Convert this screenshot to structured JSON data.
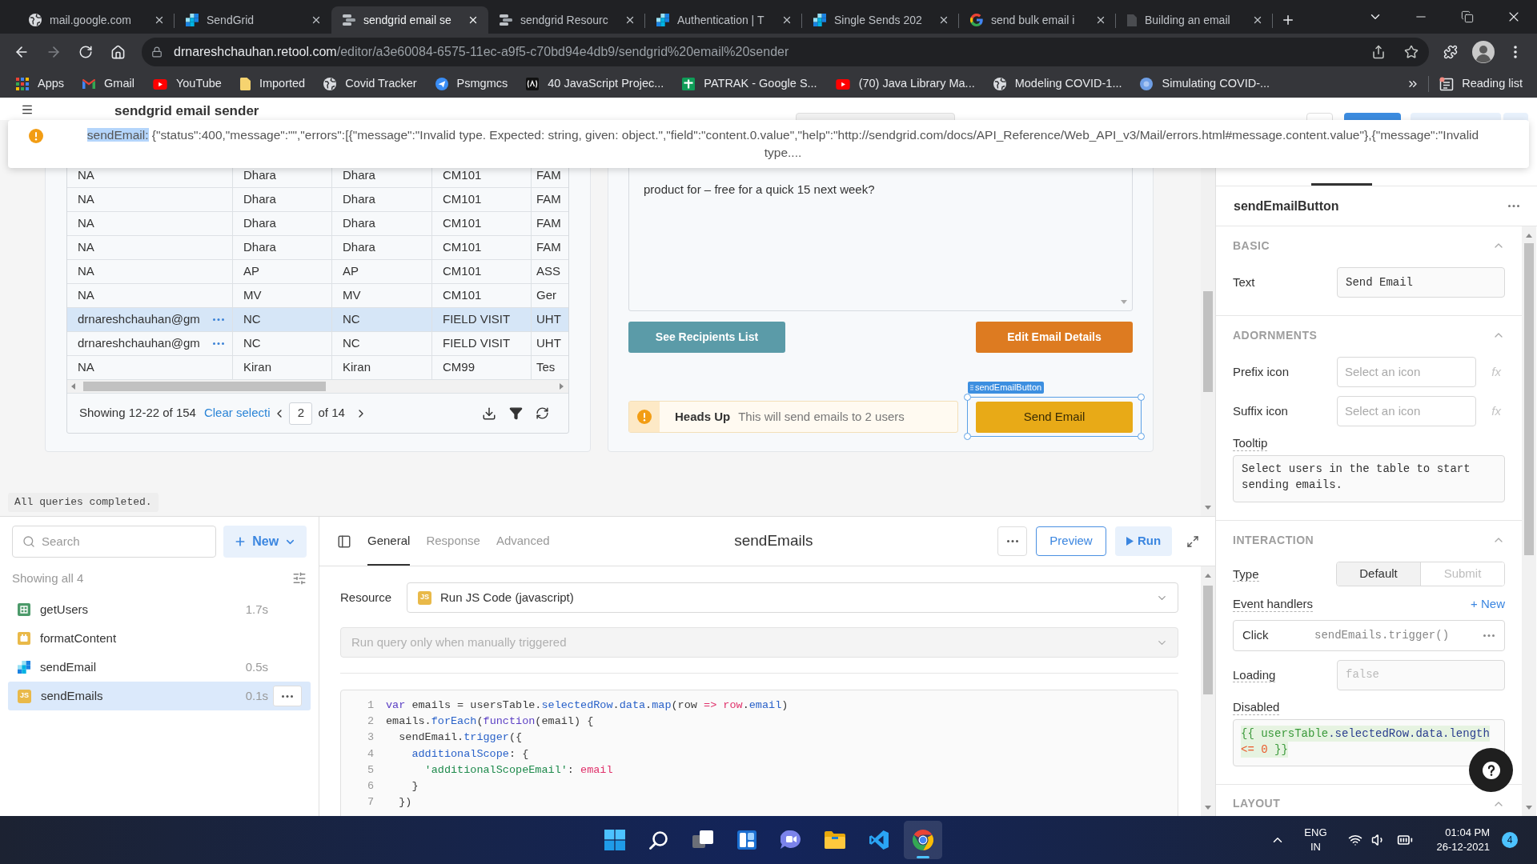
{
  "browser": {
    "tabs": [
      {
        "title": "mail.google.com",
        "selected": false
      },
      {
        "title": "SendGrid",
        "selected": false
      },
      {
        "title": "sendgrid email se",
        "selected": true
      },
      {
        "title": "sendgrid Resourc",
        "selected": false
      },
      {
        "title": "Authentication | T",
        "selected": false
      },
      {
        "title": "Single Sends 202",
        "selected": false
      },
      {
        "title": "send bulk email i",
        "selected": false
      },
      {
        "title": "Building an email",
        "selected": false
      }
    ],
    "url": {
      "host": "drnareshchauhan.retool.com",
      "path": "/editor/a3e60084-6575-11ec-a9f5-c70bd94e4db9/sendgrid%20email%20sender"
    },
    "bookmarks": [
      {
        "label": "Apps"
      },
      {
        "label": "Gmail"
      },
      {
        "label": "YouTube"
      },
      {
        "label": "Imported"
      },
      {
        "label": "Covid Tracker"
      },
      {
        "label": "Psmgmcs"
      },
      {
        "label": "40 JavaScript Projec..."
      },
      {
        "label": "PATRAK - Google S..."
      },
      {
        "label": "(70) Java Library Ma..."
      },
      {
        "label": "Modeling COVID-1..."
      },
      {
        "label": "Simulating COVID-..."
      }
    ],
    "reading_list": "Reading list"
  },
  "app": {
    "title": "sendgrid email sender"
  },
  "toast": {
    "source": "sendEmail:",
    "source_selected": true,
    "message": "{\"status\":400,\"message\":\"\",\"errors\":[{\"message\":\"Invalid type. Expected: string, given: object.\",\"field\":\"content.0.value\",\"help\":\"http://sendgrid.com/docs/API_Reference/Web_API_v3/Mail/errors.html#message.content.value\"},{\"message\":\"Invalid type...."
  },
  "table": {
    "rows": [
      {
        "cells": [
          "NA",
          "Dhara",
          "Dhara",
          "CM101",
          "FAM"
        ],
        "more": false,
        "selected": false
      },
      {
        "cells": [
          "NA",
          "Dhara",
          "Dhara",
          "CM101",
          "FAM"
        ],
        "more": false,
        "selected": false
      },
      {
        "cells": [
          "NA",
          "Dhara",
          "Dhara",
          "CM101",
          "FAM"
        ],
        "more": false,
        "selected": false
      },
      {
        "cells": [
          "NA",
          "Dhara",
          "Dhara",
          "CM101",
          "FAM"
        ],
        "more": false,
        "selected": false
      },
      {
        "cells": [
          "NA",
          "AP",
          "AP",
          "CM101",
          "ASS"
        ],
        "more": false,
        "selected": false
      },
      {
        "cells": [
          "NA",
          "MV",
          "MV",
          "CM101",
          "Ger"
        ],
        "more": false,
        "selected": false
      },
      {
        "cells": [
          "drnareshchauhan@gm",
          "NC",
          "NC",
          "FIELD VISIT",
          "UHT"
        ],
        "more": true,
        "selected": true
      },
      {
        "cells": [
          "drnareshchauhan@gm",
          "NC",
          "NC",
          "FIELD VISIT",
          "UHT"
        ],
        "more": true,
        "selected": false
      },
      {
        "cells": [
          "NA",
          "Kiran",
          "Kiran",
          "CM99",
          "Tes"
        ],
        "more": false,
        "selected": false
      }
    ],
    "footer": {
      "summary": "Showing 12-22 of 154",
      "clear": "Clear selecti",
      "page": "2",
      "pages": "of 14"
    }
  },
  "email_panel": {
    "body": "product for – free for a quick 15 next week?",
    "recipients_button": "See Recipients List",
    "edit_button": "Edit Email Details",
    "alert": {
      "title": "Heads Up",
      "message": "This will send emails to 2 users"
    },
    "send_button": "Send Email",
    "selected_component": "sendEmailButton"
  },
  "status": "All queries completed.",
  "queries": {
    "search": {
      "placeholder": "Search"
    },
    "new_button": "New",
    "summary": "Showing all 4",
    "items": [
      {
        "name": "getUsers",
        "kind": "table",
        "time": "1.7s",
        "selected": false
      },
      {
        "name": "formatContent",
        "kind": "transformer",
        "selected": false
      },
      {
        "name": "sendEmail",
        "kind": "squares",
        "time": "0.5s",
        "selected": false
      },
      {
        "name": "sendEmails",
        "kind": "js",
        "badge": "JS",
        "time": "0.1s",
        "selected": true
      }
    ]
  },
  "editor": {
    "tabs": [
      {
        "label": "General",
        "selected": true
      },
      {
        "label": "Response",
        "selected": false
      },
      {
        "label": "Advanced",
        "selected": false
      }
    ],
    "title": "sendEmails",
    "preview": "Preview",
    "run": "Run",
    "resource": {
      "label": "Resource",
      "badge": "JS",
      "value": "Run JS Code (javascript)"
    },
    "trigger": {
      "value": "Run query only when manually triggered",
      "disabled": true
    },
    "code": [
      {
        "number": "1",
        "tokens": [
          {
            "kind": "keyword",
            "text": "var"
          },
          {
            "kind": "plain",
            "text": " emails = usersTable."
          },
          {
            "kind": "prop",
            "text": "selectedRow"
          },
          {
            "kind": "plain",
            "text": "."
          },
          {
            "kind": "prop",
            "text": "data"
          },
          {
            "kind": "plain",
            "text": "."
          },
          {
            "kind": "prop",
            "text": "map"
          },
          {
            "kind": "plain",
            "text": "(row "
          },
          {
            "kind": "op",
            "text": "=>"
          },
          {
            "kind": "var",
            "text": " row"
          },
          {
            "kind": "plain",
            "text": "."
          },
          {
            "kind": "prop",
            "text": "email"
          },
          {
            "kind": "plain",
            "text": ")"
          }
        ]
      },
      {
        "number": "2",
        "tokens": [
          {
            "kind": "plain",
            "text": "emails."
          },
          {
            "kind": "prop",
            "text": "forEach"
          },
          {
            "kind": "plain",
            "text": "("
          },
          {
            "kind": "keyword",
            "text": "function"
          },
          {
            "kind": "plain",
            "text": "(email) {"
          }
        ]
      },
      {
        "number": "3",
        "tokens": [
          {
            "kind": "plain",
            "text": "  sendEmail."
          },
          {
            "kind": "prop",
            "text": "trigger"
          },
          {
            "kind": "plain",
            "text": "({"
          }
        ]
      },
      {
        "number": "4",
        "tokens": [
          {
            "kind": "prop",
            "text": "    additionalScope"
          },
          {
            "kind": "plain",
            "text": ": {"
          }
        ]
      },
      {
        "number": "5",
        "tokens": [
          {
            "kind": "string",
            "text": "      'additionalScopeEmail'"
          },
          {
            "kind": "plain",
            "text": ": "
          },
          {
            "kind": "var",
            "text": "email"
          }
        ]
      },
      {
        "number": "6",
        "tokens": [
          {
            "kind": "plain",
            "text": "    }"
          }
        ]
      },
      {
        "number": "7",
        "tokens": [
          {
            "kind": "plain",
            "text": "  })"
          }
        ]
      }
    ]
  },
  "inspector": {
    "component": "sendEmailButton",
    "sections": [
      {
        "title": "BASIC",
        "expanded": true,
        "fields": [
          {
            "kind": "input",
            "label": "Text",
            "underlined": false,
            "value": "Send Email"
          }
        ]
      },
      {
        "title": "ADORNMENTS",
        "expanded": true,
        "fields": [
          {
            "kind": "picker",
            "label": "Prefix icon",
            "underlined": false,
            "placeholder": "Select an icon",
            "action": "fx"
          },
          {
            "kind": "picker",
            "label": "Suffix icon",
            "underlined": false,
            "placeholder": "Select an icon",
            "action": "fx"
          },
          {
            "kind": "textarea",
            "label": "Tooltip",
            "underlined": true,
            "value": "Select users in the table to start sending emails."
          }
        ]
      },
      {
        "title": "INTERACTION",
        "expanded": true,
        "fields": [
          {
            "kind": "segmented",
            "label": "Type",
            "underlined": true,
            "options": [
              {
                "label": "Default",
                "selected": true
              },
              {
                "label": "Submit",
                "selected": false
              }
            ]
          },
          {
            "kind": "handlers",
            "label": "Event handlers",
            "underlined": true,
            "add": "+ New",
            "handlers": [
              {
                "event": "Click",
                "action": "sendEmails.trigger()"
              }
            ]
          },
          {
            "kind": "input",
            "label": "Loading",
            "underlined": true,
            "placeholder": "false"
          },
          {
            "kind": "code",
            "label": "Disabled",
            "underlined": true,
            "lines": [
              [
                {
                  "kind": "scope",
                  "text": "{{ usersTable"
                },
                {
                  "kind": "member",
                  "text": ".selectedRow.data.length"
                }
              ],
              [
                {
                  "kind": "compare",
                  "text": "<= 0"
                },
                {
                  "kind": "scope",
                  "text": " }}"
                }
              ]
            ]
          }
        ]
      },
      {
        "title": "LAYOUT",
        "expanded": true
      }
    ]
  },
  "taskbar": {
    "apps": [
      {
        "selected": false
      },
      {
        "selected": false
      },
      {
        "selected": false
      },
      {
        "selected": false
      },
      {
        "selected": false
      },
      {
        "selected": false
      },
      {
        "selected": false
      },
      {
        "selected": true
      }
    ],
    "language": "ENG",
    "region": "IN",
    "time": "01:04 PM",
    "date": "26-12-2021",
    "notifications": "4"
  }
}
